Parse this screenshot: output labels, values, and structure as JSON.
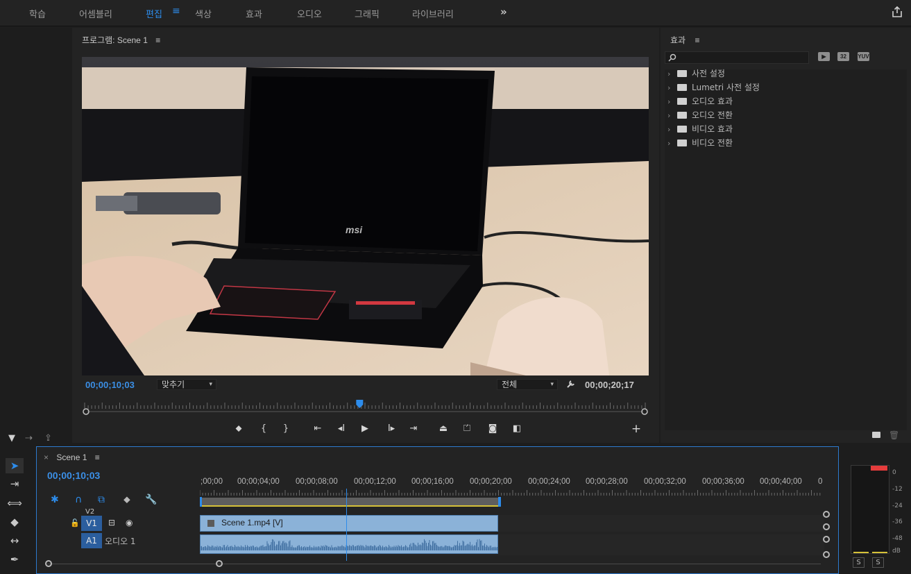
{
  "workspaces": {
    "tabs": [
      "학습",
      "어셈블리",
      "편집",
      "색상",
      "효과",
      "오디오",
      "그래픽",
      "라이브러리"
    ],
    "active": "편집",
    "menu_icon": "≡",
    "more": "»",
    "share_icon": "share-icon"
  },
  "program_monitor": {
    "title": "프로그램: Scene 1",
    "menu_icon": "≡",
    "current_timecode": "00;00;10;03",
    "fit_dropdown": "맞추기",
    "quality_dropdown": "전체",
    "duration_timecode": "00;00;20;17",
    "playhead_fraction": 0.49,
    "transport_icons": [
      "marker-icon",
      "mark-in-icon",
      "mark-out-icon",
      "go-to-in-icon",
      "step-back-icon",
      "play-icon",
      "step-forward-icon",
      "go-to-out-icon",
      "lift-icon",
      "extract-icon",
      "export-frame-icon",
      "compare-icon",
      "add-button-icon"
    ],
    "video_description_icon": "laptop-video-frame"
  },
  "effects_panel": {
    "title": "효과",
    "menu_icon": "≡",
    "search_placeholder": "",
    "badges": [
      "32",
      "YUV"
    ],
    "items": [
      {
        "label": "사전 설정",
        "icon": "preset-folder-icon"
      },
      {
        "label": "Lumetri 사전 설정",
        "icon": "preset-folder-icon"
      },
      {
        "label": "오디오 효과",
        "icon": "folder-icon"
      },
      {
        "label": "오디오 전환",
        "icon": "folder-icon"
      },
      {
        "label": "비디오 효과",
        "icon": "folder-icon"
      },
      {
        "label": "비디오 전환",
        "icon": "folder-icon"
      }
    ]
  },
  "timeline": {
    "sequence_name": "Scene 1",
    "close": "×",
    "menu_icon": "≡",
    "current_timecode": "00;00;10;03",
    "ruler_labels": [
      ";00;00",
      "00;00;04;00",
      "00;00;08;00",
      "00;00;12;00",
      "00;00;16;00",
      "00;00;20;00",
      "00;00;24;00",
      "00;00;28;00",
      "00;00;32;00",
      "00;00;36;00",
      "00;00;40;00",
      "0"
    ],
    "tracks": {
      "v2_label": "V2",
      "v1_label": "V1",
      "a1_label": "A1",
      "a1_name": "오디오 1"
    },
    "clip_name": "Scene 1.mp4 [V]",
    "playhead_fraction": 0.236
  },
  "audio_meter": {
    "labels": [
      "0",
      "-12",
      "-24",
      "-36",
      "-48",
      "dB"
    ],
    "solo_labels": [
      "S",
      "S"
    ]
  },
  "colors": {
    "accent": "#2d8ceb",
    "clip": "#8bb2d8",
    "panel": "#232323",
    "background": "#1d1d1d",
    "meter_peak": "#e53c3c"
  }
}
